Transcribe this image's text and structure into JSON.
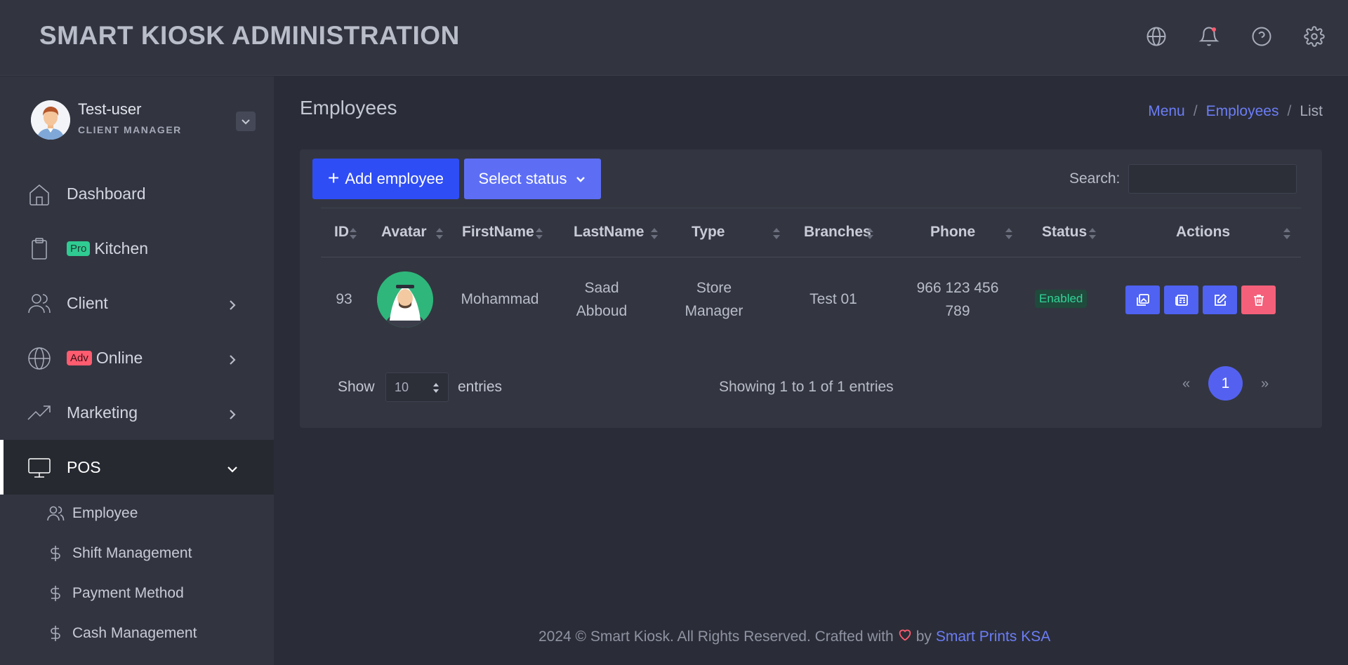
{
  "header": {
    "title": "SMART KIOSK ADMINISTRATION",
    "icons": [
      "globe-icon",
      "bell-icon",
      "help-icon",
      "gear-icon"
    ]
  },
  "user": {
    "name": "Test-user",
    "role": "CLIENT MANAGER"
  },
  "sidebar": {
    "items": [
      {
        "label": "Dashboard",
        "icon": "home-icon"
      },
      {
        "label": "Kitchen",
        "icon": "clipboard-icon",
        "badge": "Pro"
      },
      {
        "label": "Client",
        "icon": "users-icon"
      },
      {
        "label": "Online",
        "icon": "globe-icon",
        "badge": "Adv"
      },
      {
        "label": "Marketing",
        "icon": "trending-up-icon"
      },
      {
        "label": "POS",
        "icon": "monitor-icon"
      }
    ],
    "subitems": [
      {
        "label": "Employee",
        "icon": "users-icon"
      },
      {
        "label": "Shift Management",
        "icon": "dollar-icon"
      },
      {
        "label": "Payment Method",
        "icon": "dollar-icon"
      },
      {
        "label": "Cash Management",
        "icon": "dollar-icon"
      }
    ]
  },
  "page": {
    "title": "Employees",
    "breadcrumb": [
      "Menu",
      "Employees",
      "List"
    ]
  },
  "toolbar": {
    "add_label": "Add employee",
    "status_label": "Select status",
    "search_label": "Search:",
    "search_value": ""
  },
  "table": {
    "columns": [
      "ID",
      "Avatar",
      "FirstName",
      "LastName",
      "Type",
      "Branches",
      "Phone",
      "Status",
      "Actions"
    ],
    "rows": [
      {
        "id": "93",
        "first_name": "Mohammad",
        "last_name_1": "Saad",
        "last_name_2": "Abboud",
        "type_1": "Store",
        "type_2": "Manager",
        "branches": "Test 01",
        "phone_1": "966 123 456",
        "phone_2": "789",
        "status": "Enabled"
      }
    ]
  },
  "pagination": {
    "show_label": "Show",
    "page_size": "10",
    "entries_label": "entries",
    "info": "Showing 1 to 1 of 1 entries",
    "prev": "«",
    "current_page": "1",
    "next": "»"
  },
  "footer": {
    "text": "2024 © Smart Kiosk. All Rights Reserved. Crafted with",
    "by": "by",
    "brand": "Smart Prints KSA"
  },
  "colors": {
    "accent": "#2f4df5",
    "accent_light": "#5d6ef5",
    "danger": "#f4607a",
    "success": "#34d399",
    "background": "#2a2d37",
    "panel": "#323540"
  }
}
